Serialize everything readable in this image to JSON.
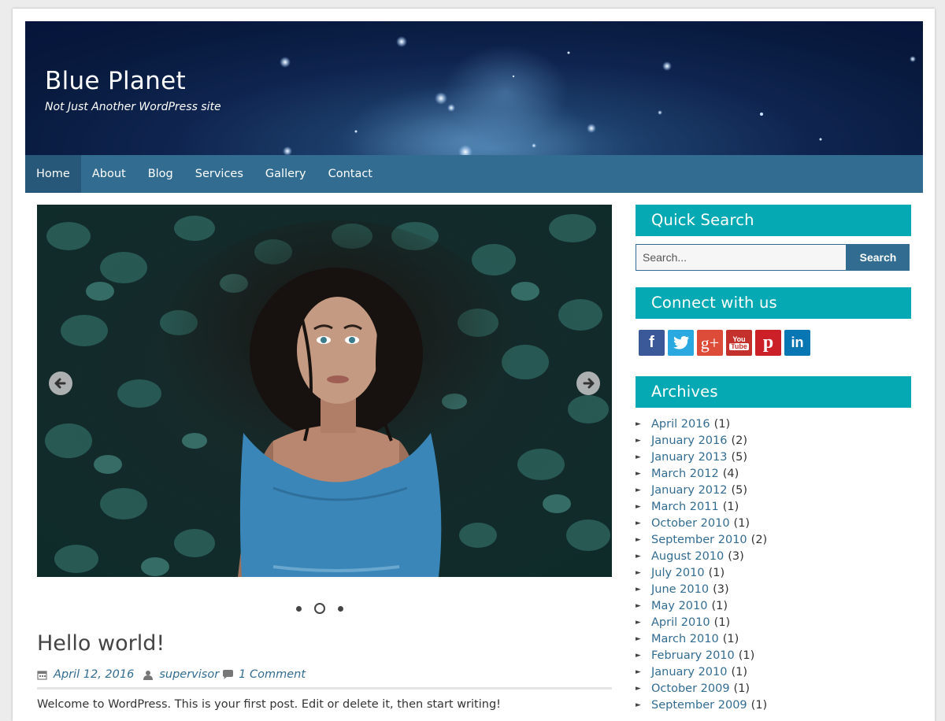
{
  "site": {
    "title": "Blue Planet",
    "description": "Not Just Another WordPress site"
  },
  "nav": {
    "items": [
      {
        "label": "Home",
        "active": true
      },
      {
        "label": "About"
      },
      {
        "label": "Blog"
      },
      {
        "label": "Services"
      },
      {
        "label": "Gallery"
      },
      {
        "label": "Contact"
      }
    ]
  },
  "slider": {
    "prev_icon": "arrow-left-circle-icon",
    "next_icon": "arrow-right-circle-icon",
    "slide_count": 3,
    "active_slide": 2
  },
  "post": {
    "title": "Hello world!",
    "date": "April 12, 2016",
    "author": "supervisor",
    "comments": "1 Comment",
    "excerpt": "Welcome to WordPress. This is your first post. Edit or delete it, then start writing!"
  },
  "sidebar": {
    "quick_search_title": "Quick Search",
    "search_placeholder": "Search...",
    "search_button": "Search",
    "connect_title": "Connect with us",
    "social": [
      {
        "name": "facebook-icon",
        "glyph": "f",
        "color": "#3b5998"
      },
      {
        "name": "twitter-icon",
        "glyph": "t",
        "color": "#2aa9e0"
      },
      {
        "name": "google-plus-icon",
        "glyph": "g+",
        "color": "#dd4b39"
      },
      {
        "name": "youtube-icon",
        "glyph": "You Tube",
        "color": "#c4302b"
      },
      {
        "name": "pinterest-icon",
        "glyph": "p",
        "color": "#cb2027"
      },
      {
        "name": "linkedin-icon",
        "glyph": "in",
        "color": "#0976b4"
      }
    ],
    "archives_title": "Archives",
    "archives": [
      {
        "label": "April 2016",
        "count": "(1)"
      },
      {
        "label": "January 2016",
        "count": "(2)"
      },
      {
        "label": "January 2013",
        "count": "(5)"
      },
      {
        "label": "March 2012",
        "count": "(4)"
      },
      {
        "label": "January 2012",
        "count": "(5)"
      },
      {
        "label": "March 2011",
        "count": "(1)"
      },
      {
        "label": "October 2010",
        "count": "(1)"
      },
      {
        "label": "September 2010",
        "count": "(2)"
      },
      {
        "label": "August 2010",
        "count": "(3)"
      },
      {
        "label": "July 2010",
        "count": "(1)"
      },
      {
        "label": "June 2010",
        "count": "(3)"
      },
      {
        "label": "May 2010",
        "count": "(1)"
      },
      {
        "label": "April 2010",
        "count": "(1)"
      },
      {
        "label": "March 2010",
        "count": "(1)"
      },
      {
        "label": "February 2010",
        "count": "(1)"
      },
      {
        "label": "January 2010",
        "count": "(1)"
      },
      {
        "label": "October 2009",
        "count": "(1)"
      },
      {
        "label": "September 2009",
        "count": "(1)"
      }
    ]
  },
  "colors": {
    "nav": "#326c91",
    "widget_title": "#04a9b3",
    "link": "#326c91"
  }
}
